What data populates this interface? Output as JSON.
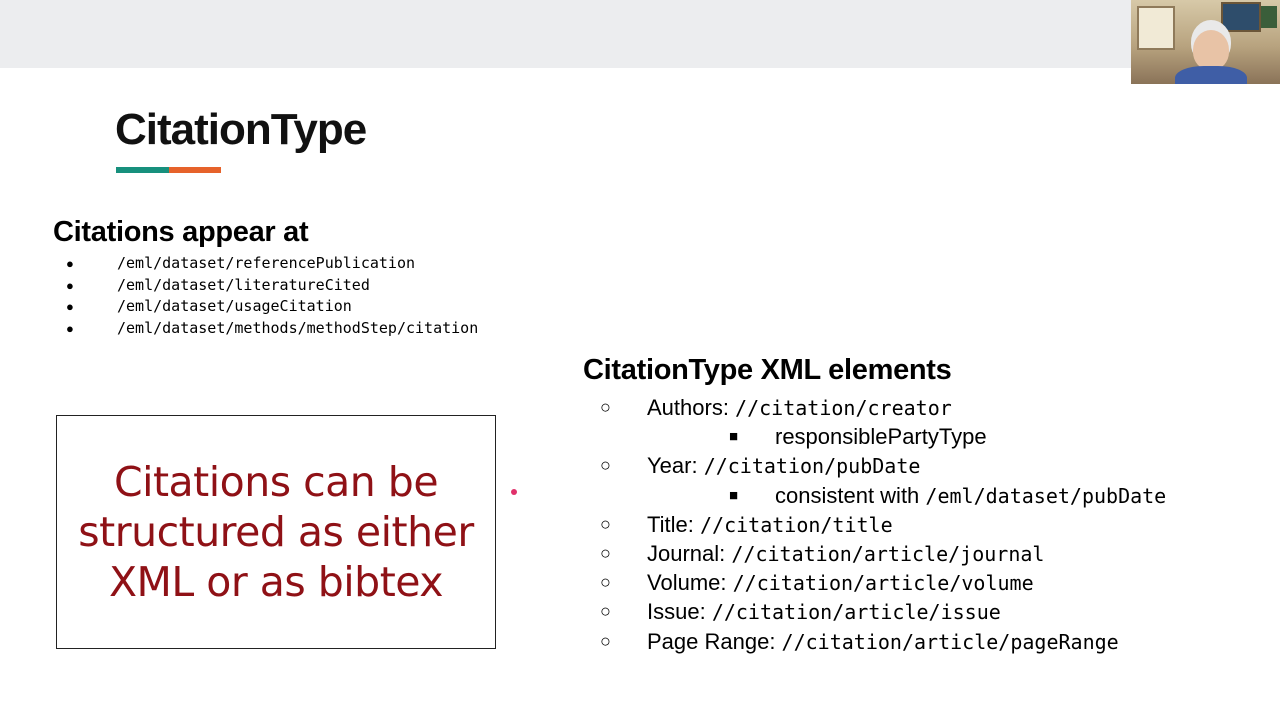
{
  "slide": {
    "title": "CitationType",
    "accent_colors": [
      "#17907d",
      "#e6622a"
    ]
  },
  "appear": {
    "heading": "Citations appear at",
    "paths": [
      "/eml/dataset/referencePublication",
      "/eml/dataset/literatureCited",
      "/eml/dataset/usageCitation",
      "/eml/dataset/methods/methodStep/citation"
    ]
  },
  "callout": {
    "text": "Citations can be structured as either XML or as bibtex",
    "color": "#8f1116"
  },
  "xml": {
    "heading": "CitationType XML elements",
    "items": [
      {
        "label": "Authors: ",
        "code": "//citation/creator"
      },
      {
        "sub_label": "responsiblePartyType",
        "sub_code": ""
      },
      {
        "label": "Year: ",
        "code": "//citation/pubDate"
      },
      {
        "sub_label": "consistent with ",
        "sub_code": "/eml/dataset/pubDate"
      },
      {
        "label": "Title: ",
        "code": "//citation/title"
      },
      {
        "label": "Journal: ",
        "code": "//citation/article/journal"
      },
      {
        "label": "Volume: ",
        "code": "//citation/article/volume"
      },
      {
        "label": "Issue: ",
        "code": "//citation/article/issue"
      },
      {
        "label": "Page Range: ",
        "code": "//citation/article/pageRange"
      }
    ]
  },
  "icons": {
    "bullet": "●",
    "ring": "○",
    "square": "■"
  }
}
